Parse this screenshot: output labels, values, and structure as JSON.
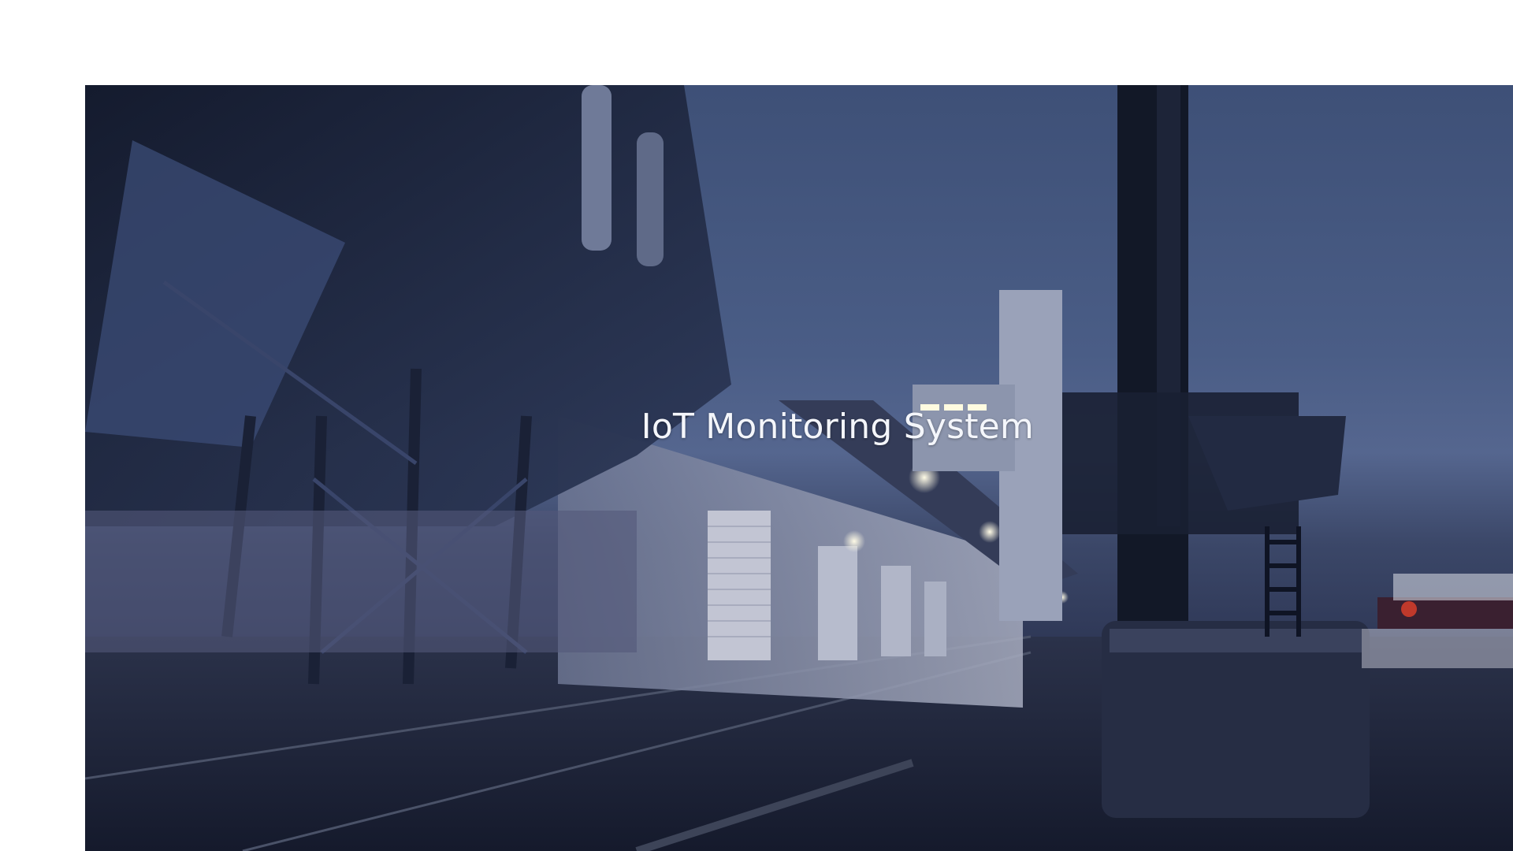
{
  "hero": {
    "title": "IoT Monitoring System",
    "background_description_icon": "industrial-dock-night-photo"
  },
  "colors": {
    "page_background": "#ffffff",
    "sky": "#4a5d86",
    "title_text": "#f4f6fb"
  }
}
